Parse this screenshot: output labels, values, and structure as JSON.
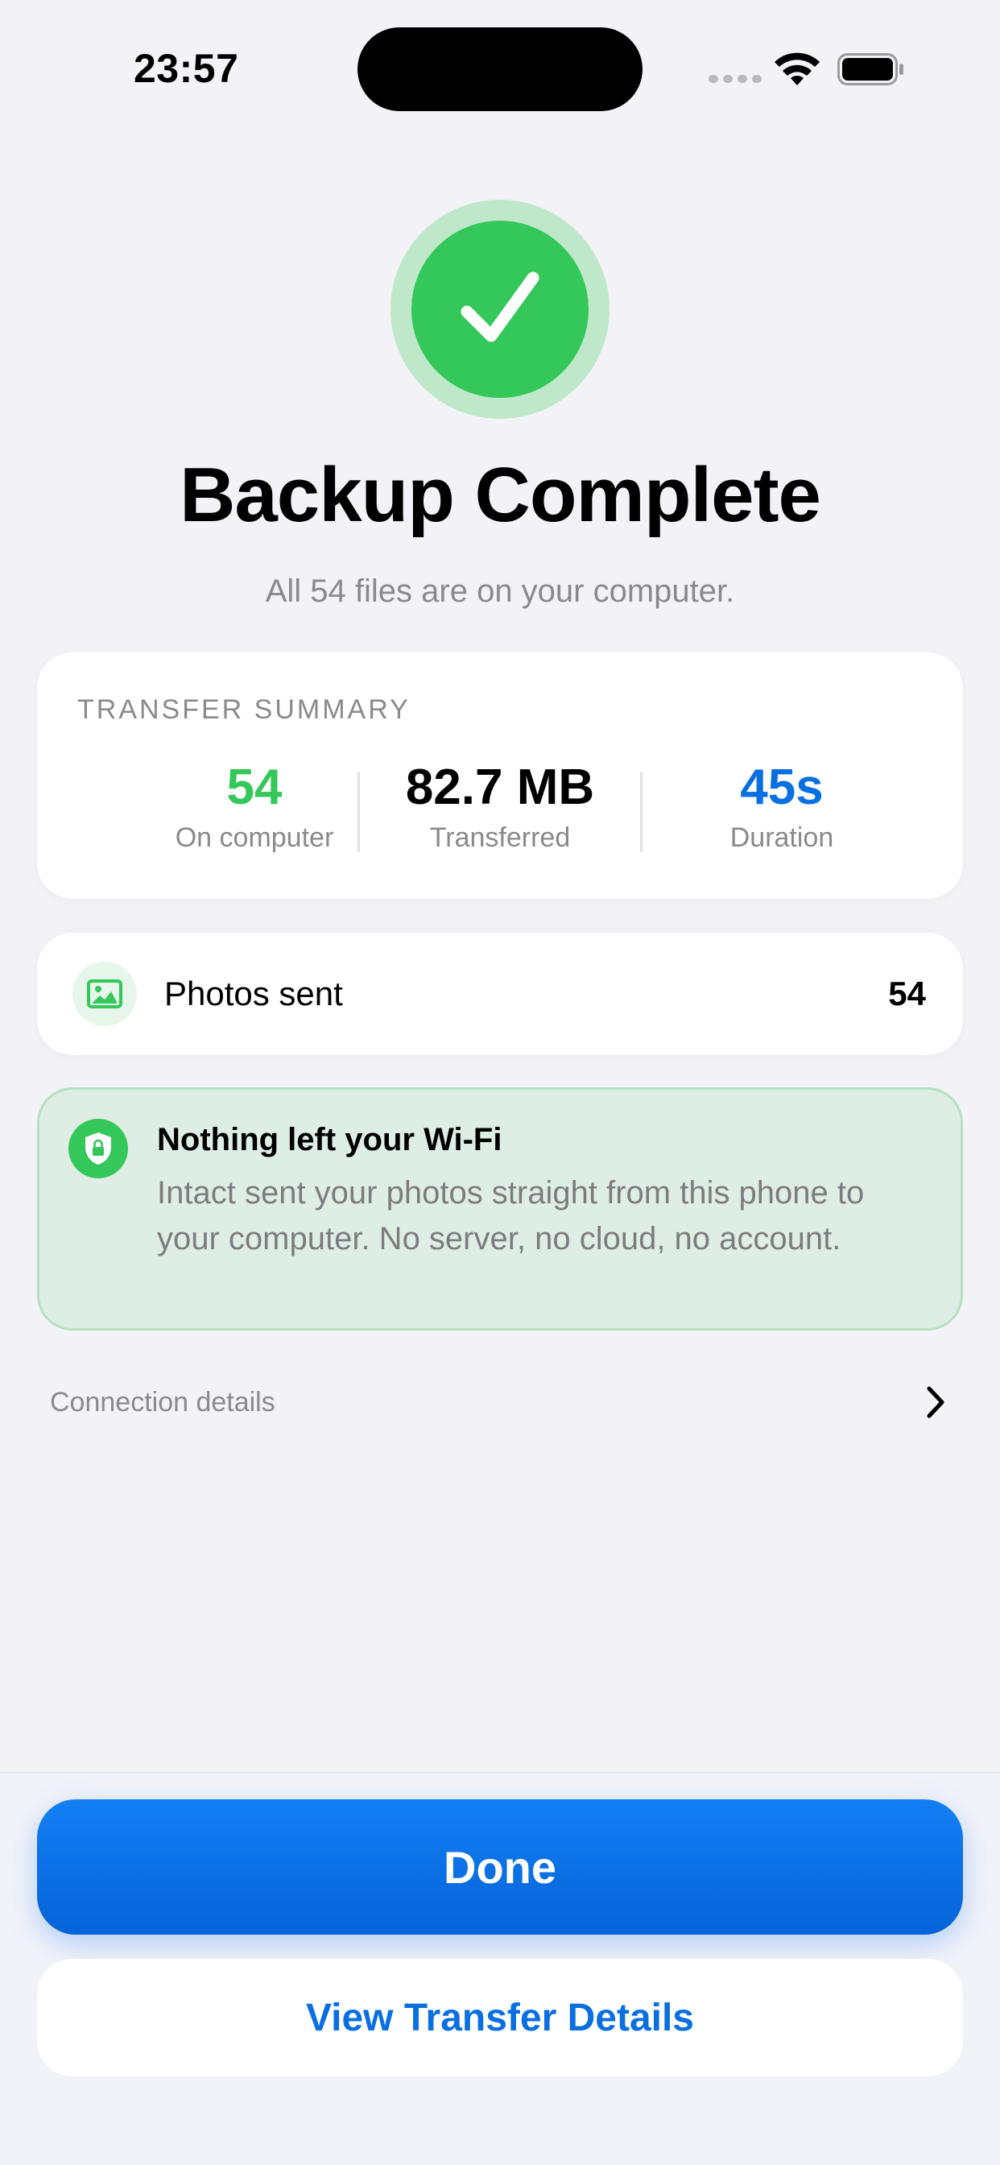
{
  "status_bar": {
    "time": "23:57",
    "icons": [
      "cellular-signal-icon",
      "wifi-icon",
      "battery-icon"
    ]
  },
  "hero": {
    "icon": "checkmark-icon",
    "title": "Backup Complete",
    "subtitle": "All 54 files are on your computer."
  },
  "summary": {
    "label": "TRANSFER SUMMARY",
    "stats": [
      {
        "value": "54",
        "label": "On computer",
        "color": "#34c759"
      },
      {
        "value": "82.7 MB",
        "label": "Transferred",
        "color": "#000000"
      },
      {
        "value": "45s",
        "label": "Duration",
        "color": "#0a6fe0"
      }
    ]
  },
  "photos": {
    "icon": "photo-icon",
    "label": "Photos sent",
    "count": "54"
  },
  "privacy_note": {
    "icon": "shield-lock-icon",
    "title": "Nothing left your Wi-Fi",
    "body": "Intact sent your photos straight from this phone to your computer. No server, no cloud, no account."
  },
  "connection": {
    "label": "Connection details",
    "icon": "chevron-right-icon"
  },
  "actions": {
    "done_label": "Done",
    "details_label": "View Transfer Details"
  },
  "colors": {
    "accent_blue": "#0a6fe0",
    "success_green": "#34c759",
    "background": "#f2f2f7"
  }
}
